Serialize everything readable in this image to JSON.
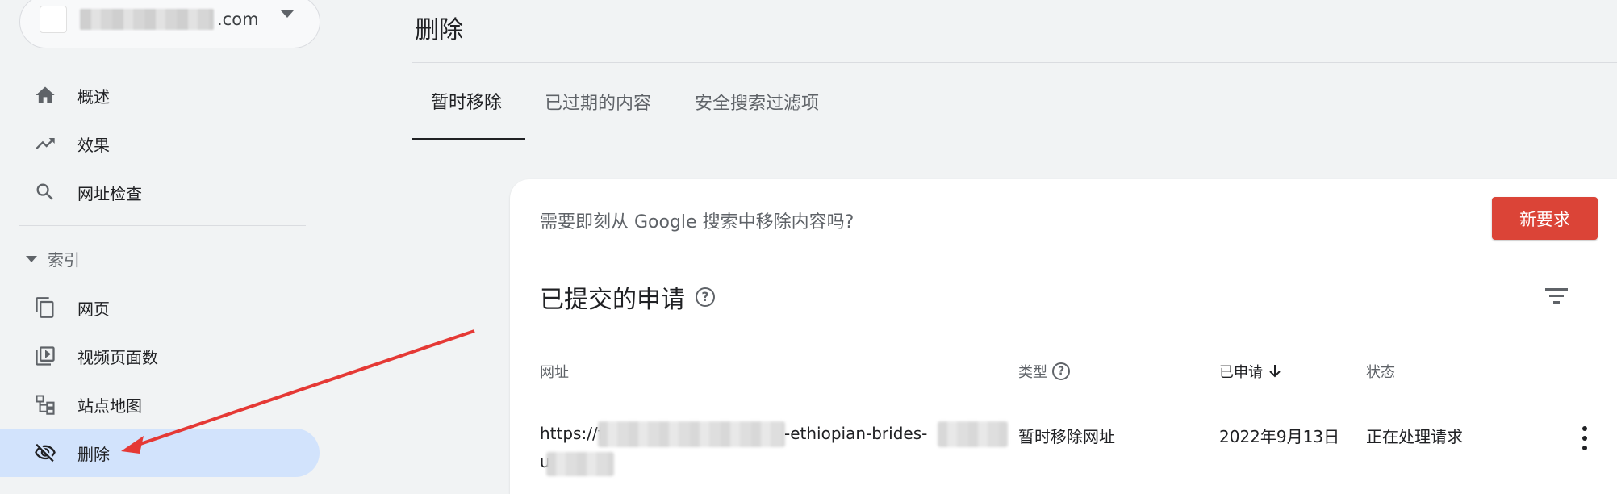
{
  "property": {
    "domain_suffix": ".com"
  },
  "sidebar": {
    "items_top": [
      {
        "label": "概述",
        "icon": "home-icon"
      },
      {
        "label": "效果",
        "icon": "trending-up-icon"
      },
      {
        "label": "网址检查",
        "icon": "search-icon"
      }
    ],
    "section": {
      "label": "索引"
    },
    "items_index": [
      {
        "label": "网页",
        "icon": "pages-icon"
      },
      {
        "label": "视频页面数",
        "icon": "video-pages-icon"
      },
      {
        "label": "站点地图",
        "icon": "sitemap-icon"
      },
      {
        "label": "删除",
        "icon": "eye-off-icon",
        "active": true
      }
    ]
  },
  "page": {
    "title": "删除"
  },
  "tabs": [
    {
      "label": "暂时移除",
      "active": true
    },
    {
      "label": "已过期的内容",
      "active": false
    },
    {
      "label": "安全搜索过滤项",
      "active": false
    }
  ],
  "card": {
    "prompt": "需要即刻从 Google 搜索中移除内容吗?",
    "new_request_label": "新要求",
    "submitted_title": "已提交的申请",
    "columns": {
      "url": "网址",
      "type": "类型",
      "requested": "已申请",
      "status": "状态"
    },
    "rows": [
      {
        "url_prefix": "https://f",
        "url_mid": "-ethiopian-brides-",
        "url_line2": "u",
        "type": "暂时移除网址",
        "requested": "2022年9月13日",
        "status": "正在处理请求"
      }
    ]
  },
  "colors": {
    "accent_red": "#db4437",
    "active_nav_bg": "#d2e3fc",
    "annotation_arrow": "#e53935"
  }
}
